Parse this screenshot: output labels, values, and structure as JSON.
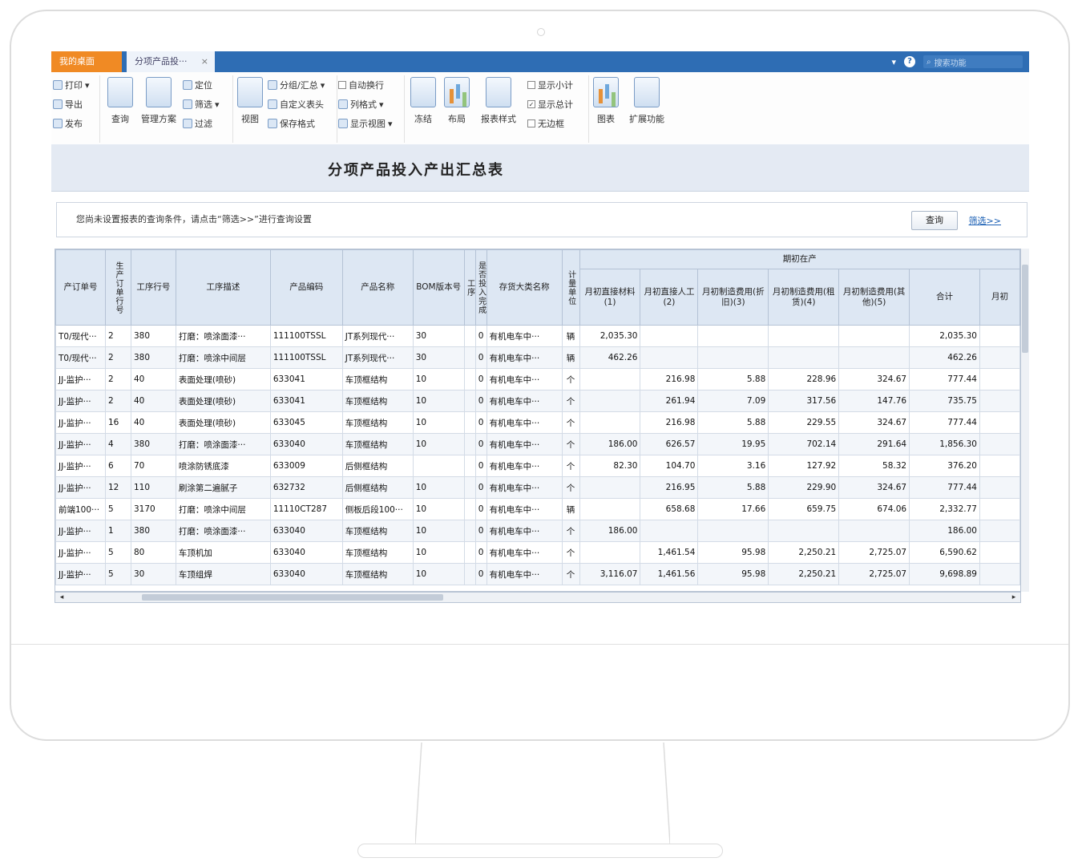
{
  "window": {
    "home_tab": "我的桌面",
    "active_tab": "分项产品投···",
    "close_glyph": "×",
    "search_placeholder": "搜索功能"
  },
  "ribbon": {
    "print": "打印",
    "export": "导出",
    "publish": "发布",
    "query": "查询",
    "manage_scheme": "管理方案",
    "locate": "定位",
    "filter": "筛选",
    "sort": "过滤",
    "view": "视图",
    "group_summary": "分组/汇总",
    "custom_header": "自定义表头",
    "save_format": "保存格式",
    "auto_width": "自动换行",
    "column_format": "列格式",
    "show_view": "显示视图",
    "freeze": "冻结",
    "layout": "布局",
    "style": "报表样式",
    "show_subtotal": "显示小计",
    "show_total": "显示总计",
    "no_border": "无边框",
    "chart": "图表",
    "extend": "扩展功能"
  },
  "report": {
    "title": "分项产品投入产出汇总表",
    "hint": "您尚未设置报表的查询条件，请点击“筛选>>”进行查询设置",
    "query_button": "查询",
    "filter_link": "筛选>>"
  },
  "table": {
    "group_header": "期初在产",
    "headers": [
      "产订单号",
      "生产订单行号",
      "工序行号",
      "工序描述",
      "产品编码",
      "产品名称",
      "BOM版本号",
      "工序",
      "是否投入完成",
      "存货大类名称",
      "计量单位",
      "月初直接材料(1)",
      "月初直接人工(2)",
      "月初制造费用(折旧)(3)",
      "月初制造费用(租赁)(4)",
      "月初制造费用(其他)(5)",
      "合计",
      "月初"
    ],
    "rows": [
      [
        "T0/现代···",
        "2",
        "380",
        "打磨：喷涂面漆···",
        "111100TSSL",
        "JT系列现代···",
        "30",
        "0",
        "有机电车中···",
        "辆",
        "2,035.30",
        "",
        "",
        "",
        "",
        "2,035.30",
        ""
      ],
      [
        "T0/现代···",
        "2",
        "380",
        "打磨：喷涂中间层",
        "111100TSSL",
        "JT系列现代···",
        "30",
        "0",
        "有机电车中···",
        "辆",
        "462.26",
        "",
        "",
        "",
        "",
        "462.26",
        ""
      ],
      [
        "JJ-监护···",
        "2",
        "40",
        "表面处理(喷砂)",
        "633041",
        "车顶框结构",
        "10",
        "0",
        "有机电车中···",
        "个",
        "",
        "216.98",
        "5.88",
        "228.96",
        "324.67",
        "777.44",
        ""
      ],
      [
        "JJ-监护···",
        "2",
        "40",
        "表面处理(喷砂)",
        "633041",
        "车顶框结构",
        "10",
        "0",
        "有机电车中···",
        "个",
        "",
        "261.94",
        "7.09",
        "317.56",
        "147.76",
        "735.75",
        ""
      ],
      [
        "JJ-监护···",
        "16",
        "40",
        "表面处理(喷砂)",
        "633045",
        "车顶框结构",
        "10",
        "0",
        "有机电车中···",
        "个",
        "",
        "216.98",
        "5.88",
        "229.55",
        "324.67",
        "777.44",
        ""
      ],
      [
        "JJ-监护···",
        "4",
        "380",
        "打磨：喷涂面漆···",
        "633040",
        "车顶框结构",
        "10",
        "0",
        "有机电车中···",
        "个",
        "186.00",
        "626.57",
        "19.95",
        "702.14",
        "291.64",
        "1,856.30",
        ""
      ],
      [
        "JJ-监护···",
        "6",
        "70",
        "喷涂防锈底漆",
        "633009",
        "后侧框结构",
        "",
        "0",
        "有机电车中···",
        "个",
        "82.30",
        "104.70",
        "3.16",
        "127.92",
        "58.32",
        "376.20",
        ""
      ],
      [
        "JJ-监护···",
        "12",
        "110",
        "刷涂第二遍腻子",
        "632732",
        "后侧框结构",
        "10",
        "0",
        "有机电车中···",
        "个",
        "",
        "216.95",
        "5.88",
        "229.90",
        "324.67",
        "777.44",
        ""
      ],
      [
        "前端100···",
        "5",
        "3170",
        "打磨：喷涂中间层",
        "11110CT287",
        "侧板后段100···",
        "10",
        "0",
        "有机电车中···",
        "辆",
        "",
        "658.68",
        "17.66",
        "659.75",
        "674.06",
        "2,332.77",
        ""
      ],
      [
        "JJ-监护···",
        "1",
        "380",
        "打磨：喷涂面漆···",
        "633040",
        "车顶框结构",
        "10",
        "0",
        "有机电车中···",
        "个",
        "186.00",
        "",
        "",
        "",
        "",
        "186.00",
        ""
      ],
      [
        "JJ-监护···",
        "5",
        "80",
        "车顶机加",
        "633040",
        "车顶框结构",
        "10",
        "0",
        "有机电车中···",
        "个",
        "",
        "1,461.54",
        "95.98",
        "2,250.21",
        "2,725.07",
        "6,590.62",
        ""
      ],
      [
        "JJ-监护···",
        "5",
        "30",
        "车顶组焊",
        "633040",
        "车顶框结构",
        "10",
        "0",
        "有机电车中···",
        "个",
        "3,116.07",
        "1,461.56",
        "95.98",
        "2,250.21",
        "2,725.07",
        "9,698.89",
        ""
      ]
    ]
  }
}
